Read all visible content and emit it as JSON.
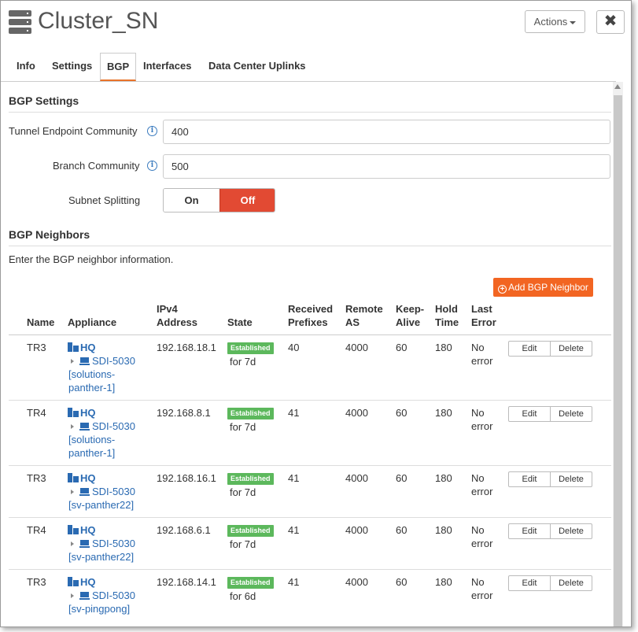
{
  "window": {
    "title": "Cluster_SN",
    "actions_label": "Actions",
    "close_label": "✖"
  },
  "tabs": [
    {
      "label": "Info"
    },
    {
      "label": "Settings"
    },
    {
      "label": "BGP"
    },
    {
      "label": "Interfaces"
    },
    {
      "label": "Data Center Uplinks"
    }
  ],
  "active_tab": "BGP",
  "bgp_settings": {
    "title": "BGP Settings",
    "tunnel_label": "Tunnel Endpoint Community",
    "tunnel_value": "400",
    "branch_label": "Branch Community",
    "branch_value": "500",
    "subnet_label": "Subnet Splitting",
    "subnet_on": "On",
    "subnet_off": "Off",
    "subnet_selected": "Off"
  },
  "neighbors": {
    "title": "BGP Neighbors",
    "description": "Enter the BGP neighbor information.",
    "add_label": "Add BGP Neighbor",
    "columns": {
      "name": "Name",
      "appliance": "Appliance",
      "ipv4_1": "IPv4",
      "ipv4_2": "Address",
      "state": "State",
      "received_1": "Received",
      "received_2": "Prefixes",
      "remote_1": "Remote",
      "remote_2": "AS",
      "keep_1": "Keep-",
      "keep_2": "Alive",
      "hold_1": "Hold",
      "hold_2": "Time",
      "last_1": "Last",
      "last_2": "Error"
    },
    "edit_label": "Edit",
    "delete_label": "Delete",
    "rows": [
      {
        "name": "TR3",
        "site": "HQ",
        "device": "SDI-5030",
        "cluster_1": "[solutions-",
        "cluster_2": "panther-1]",
        "ip": "192.168.18.1",
        "state": "Established",
        "duration": "for 7d",
        "prefixes": "40",
        "remote_as": "4000",
        "keep_alive": "60",
        "hold_time": "180",
        "error_1": "No",
        "error_2": "error"
      },
      {
        "name": "TR4",
        "site": "HQ",
        "device": "SDI-5030",
        "cluster_1": "[solutions-",
        "cluster_2": "panther-1]",
        "ip": "192.168.8.1",
        "state": "Established",
        "duration": "for 7d",
        "prefixes": "41",
        "remote_as": "4000",
        "keep_alive": "60",
        "hold_time": "180",
        "error_1": "No",
        "error_2": "error"
      },
      {
        "name": "TR3",
        "site": "HQ",
        "device": "SDI-5030",
        "cluster_1": "[sv-panther22]",
        "cluster_2": "",
        "ip": "192.168.16.1",
        "state": "Established",
        "duration": "for 7d",
        "prefixes": "41",
        "remote_as": "4000",
        "keep_alive": "60",
        "hold_time": "180",
        "error_1": "No",
        "error_2": "error"
      },
      {
        "name": "TR4",
        "site": "HQ",
        "device": "SDI-5030",
        "cluster_1": "[sv-panther22]",
        "cluster_2": "",
        "ip": "192.168.6.1",
        "state": "Established",
        "duration": "for 7d",
        "prefixes": "41",
        "remote_as": "4000",
        "keep_alive": "60",
        "hold_time": "180",
        "error_1": "No",
        "error_2": "error"
      },
      {
        "name": "TR3",
        "site": "HQ",
        "device": "SDI-5030",
        "cluster_1": "[sv-pingpong]",
        "cluster_2": "",
        "ip": "192.168.14.1",
        "state": "Established",
        "duration": "for 6d",
        "prefixes": "41",
        "remote_as": "4000",
        "keep_alive": "60",
        "hold_time": "180",
        "error_1": "No",
        "error_2": "error"
      }
    ]
  }
}
